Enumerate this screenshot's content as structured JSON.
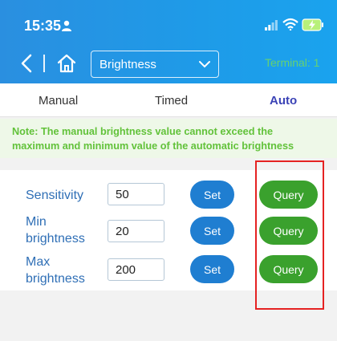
{
  "status_bar": {
    "time": "15:35"
  },
  "nav": {
    "select_value": "Brightness",
    "terminal": "Terminal: 1"
  },
  "tabs": [
    {
      "label": "Manual",
      "active": false
    },
    {
      "label": "Timed",
      "active": false
    },
    {
      "label": "Auto",
      "active": true
    }
  ],
  "note": {
    "line1": "Note: The manual brightness value cannot exceed the",
    "line2": "maximum and minimum value of the automatic brightness"
  },
  "rows": [
    {
      "label_line1": "Sensitivity",
      "label_line2": "",
      "value": "50",
      "set_label": "Set",
      "query_label": "Query"
    },
    {
      "label_line1": "Min",
      "label_line2": "brightness",
      "value": "20",
      "set_label": "Set",
      "query_label": "Query"
    },
    {
      "label_line1": "Max",
      "label_line2": "brightness",
      "value": "200",
      "set_label": "Set",
      "query_label": "Query"
    }
  ],
  "colors": {
    "header": "#1e9be8",
    "active_tab": "#3b43b6",
    "note_text": "#62c23a",
    "set_button": "#1f7ed1",
    "query_button": "#3aa12d",
    "highlight": "#e52222"
  },
  "icons": {
    "user": "user-icon",
    "signal": "signal-icon",
    "wifi": "wifi-icon",
    "battery": "battery-charging-icon",
    "back": "back-arrow-icon",
    "home": "home-icon",
    "dropdown": "chevron-down-icon"
  }
}
